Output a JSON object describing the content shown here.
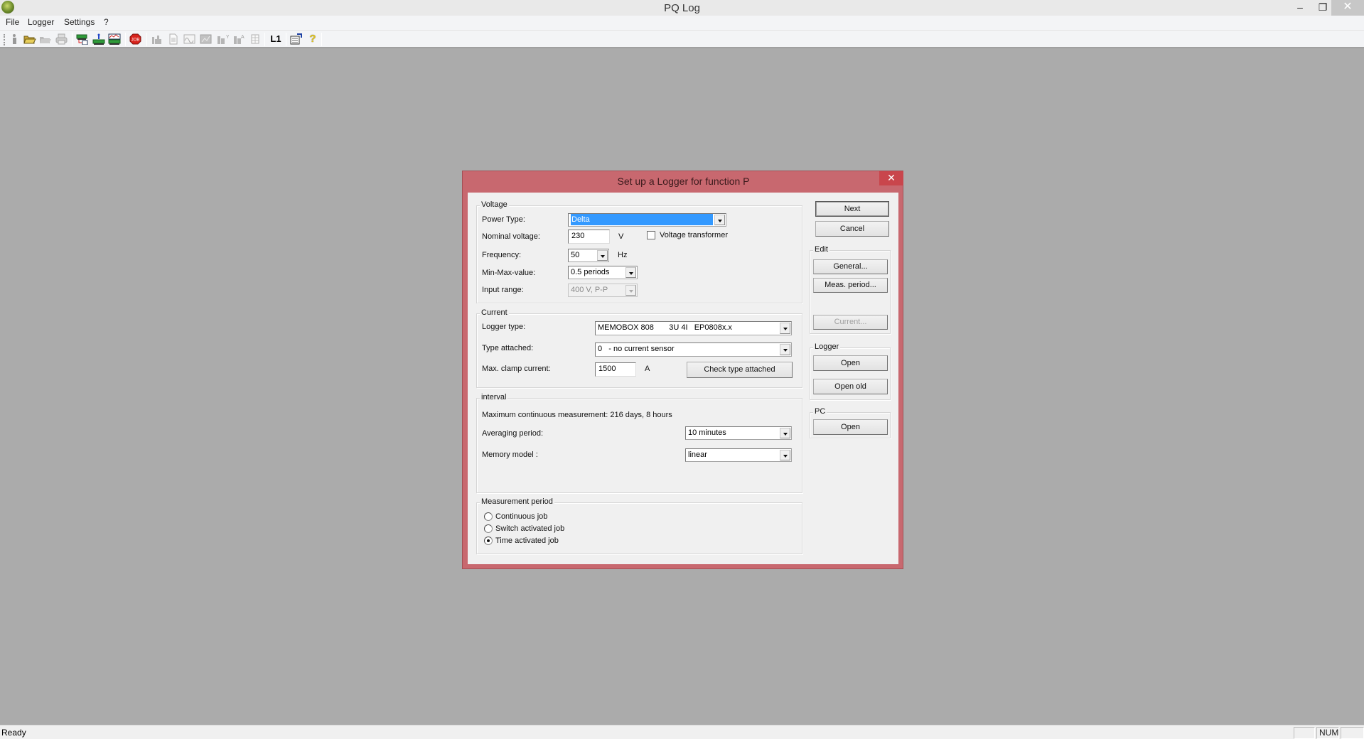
{
  "app": {
    "title": "PQ Log",
    "window_controls": {
      "minimize": "–",
      "restore": "❐",
      "close": "✕"
    }
  },
  "menu": [
    "File",
    "Logger",
    "Settings",
    "?"
  ],
  "toolbar": {
    "buttons": [
      {
        "icon": "info-icon",
        "enabled": true
      },
      {
        "icon": "open-folder-icon",
        "enabled": true
      },
      {
        "icon": "open-folder-disabled-icon",
        "enabled": false
      },
      {
        "icon": "print-icon",
        "enabled": false
      },
      {
        "icon": "logger-transfer-icon",
        "enabled": true
      },
      {
        "icon": "logger-upload-icon",
        "enabled": true
      },
      {
        "icon": "logger-chart-icon",
        "enabled": true
      },
      {
        "icon": "job-stop-icon",
        "enabled": true,
        "label": "JOB"
      },
      {
        "icon": "bar-chart-icon",
        "enabled": false
      },
      {
        "icon": "document-icon",
        "enabled": false
      },
      {
        "icon": "waveform-icon",
        "enabled": false
      },
      {
        "icon": "image-icon",
        "enabled": false
      },
      {
        "icon": "chart-y-icon",
        "enabled": false
      },
      {
        "icon": "chart-a-icon",
        "enabled": false
      },
      {
        "icon": "table-icon",
        "enabled": false
      },
      {
        "icon": "l1-icon",
        "enabled": true,
        "label": "L1"
      },
      {
        "icon": "settings-window-icon",
        "enabled": true
      },
      {
        "icon": "help-icon",
        "enabled": true,
        "label": "?"
      }
    ]
  },
  "dialog": {
    "title": "Set up a Logger for function P",
    "close": "✕",
    "voltage": {
      "group_label": "Voltage",
      "power_type_label": "Power Type:",
      "power_type_value": "Delta",
      "nominal_voltage_label": "Nominal voltage:",
      "nominal_voltage_value": "230",
      "nominal_voltage_unit": "V",
      "voltage_transformer_label": "Voltage transformer",
      "voltage_transformer_checked": false,
      "frequency_label": "Frequency:",
      "frequency_value": "50",
      "frequency_unit": "Hz",
      "minmax_label": "Min-Max-value:",
      "minmax_value": "0.5 periods",
      "input_range_label": "Input range:",
      "input_range_value": "400 V, P-P"
    },
    "current": {
      "group_label": "Current",
      "logger_type_label": "Logger type:",
      "logger_type_value": "MEMOBOX 808       3U 4I   EP0808x.x",
      "type_attached_label": "Type attached:",
      "type_attached_value": "0   - no current sensor",
      "max_clamp_label": "Max. clamp current:",
      "max_clamp_value": "1500",
      "max_clamp_unit": "A",
      "check_type_button": "Check type attached"
    },
    "interval": {
      "group_label": "interval",
      "max_measurement_text": "Maximum continuous measurement: 216 days, 8 hours",
      "averaging_label": "Averaging period:",
      "averaging_value": "10 minutes",
      "memory_label": "Memory model :",
      "memory_value": "linear"
    },
    "measurement_period": {
      "group_label": "Measurement period",
      "options": [
        {
          "label": "Continuous job",
          "checked": false
        },
        {
          "label": "Switch activated job",
          "checked": false
        },
        {
          "label": "Time activated job",
          "checked": true
        }
      ]
    },
    "buttons": {
      "next": "Next",
      "cancel": "Cancel"
    },
    "edit": {
      "group_label": "Edit",
      "general": "General...",
      "meas_period": "Meas. period...",
      "current": "Current..."
    },
    "logger": {
      "group_label": "Logger",
      "open": "Open",
      "open_old": "Open old"
    },
    "pc": {
      "group_label": "PC",
      "open": "Open"
    }
  },
  "statusbar": {
    "text": "Ready",
    "panes": [
      "",
      "NUM",
      ""
    ]
  }
}
